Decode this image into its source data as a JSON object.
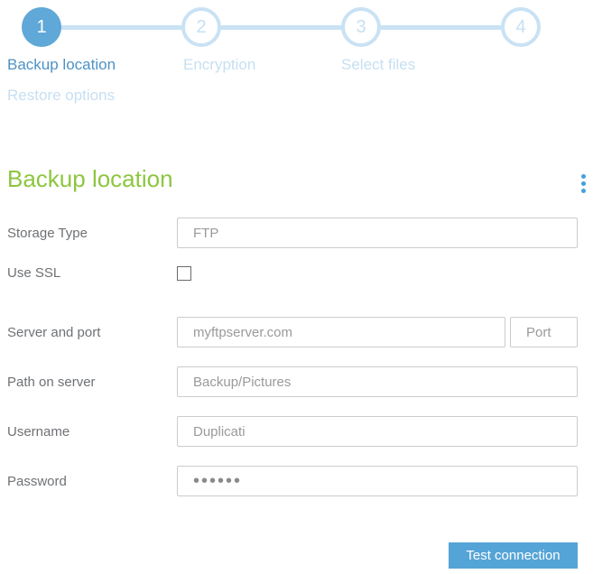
{
  "wizard": {
    "steps": [
      {
        "number": "1",
        "label": "Backup location",
        "state": "active"
      },
      {
        "number": "2",
        "label": "Encryption",
        "state": "inactive"
      },
      {
        "number": "3",
        "label": "Select files",
        "state": "inactive"
      },
      {
        "number": "4",
        "label": "Restore options",
        "state": "inactive"
      }
    ]
  },
  "page": {
    "title": "Backup location"
  },
  "form": {
    "storage_type": {
      "label": "Storage Type",
      "value": "FTP"
    },
    "use_ssl": {
      "label": "Use SSL",
      "checked": false
    },
    "server": {
      "label": "Server and port",
      "value": "myftpserver.com",
      "port_placeholder": "Port"
    },
    "path": {
      "label": "Path on server",
      "value": "Backup/Pictures"
    },
    "username": {
      "label": "Username",
      "value": "Duplicati"
    },
    "password": {
      "label": "Password",
      "value": "••••••"
    }
  },
  "actions": {
    "test_connection": "Test connection"
  },
  "icons": {
    "kebab": "kebab-menu-icon"
  },
  "colors": {
    "accent_blue": "#5fa8d8",
    "light_blue": "#c9e2f4",
    "active_label_blue": "#4d92c7",
    "inactive_label_blue": "#c6dff2",
    "heading_green": "#8dc63f",
    "button_blue": "#55a4d7",
    "label_gray": "#6e7175",
    "input_text_gray": "#9a9a9a",
    "input_border": "#cccccc"
  }
}
